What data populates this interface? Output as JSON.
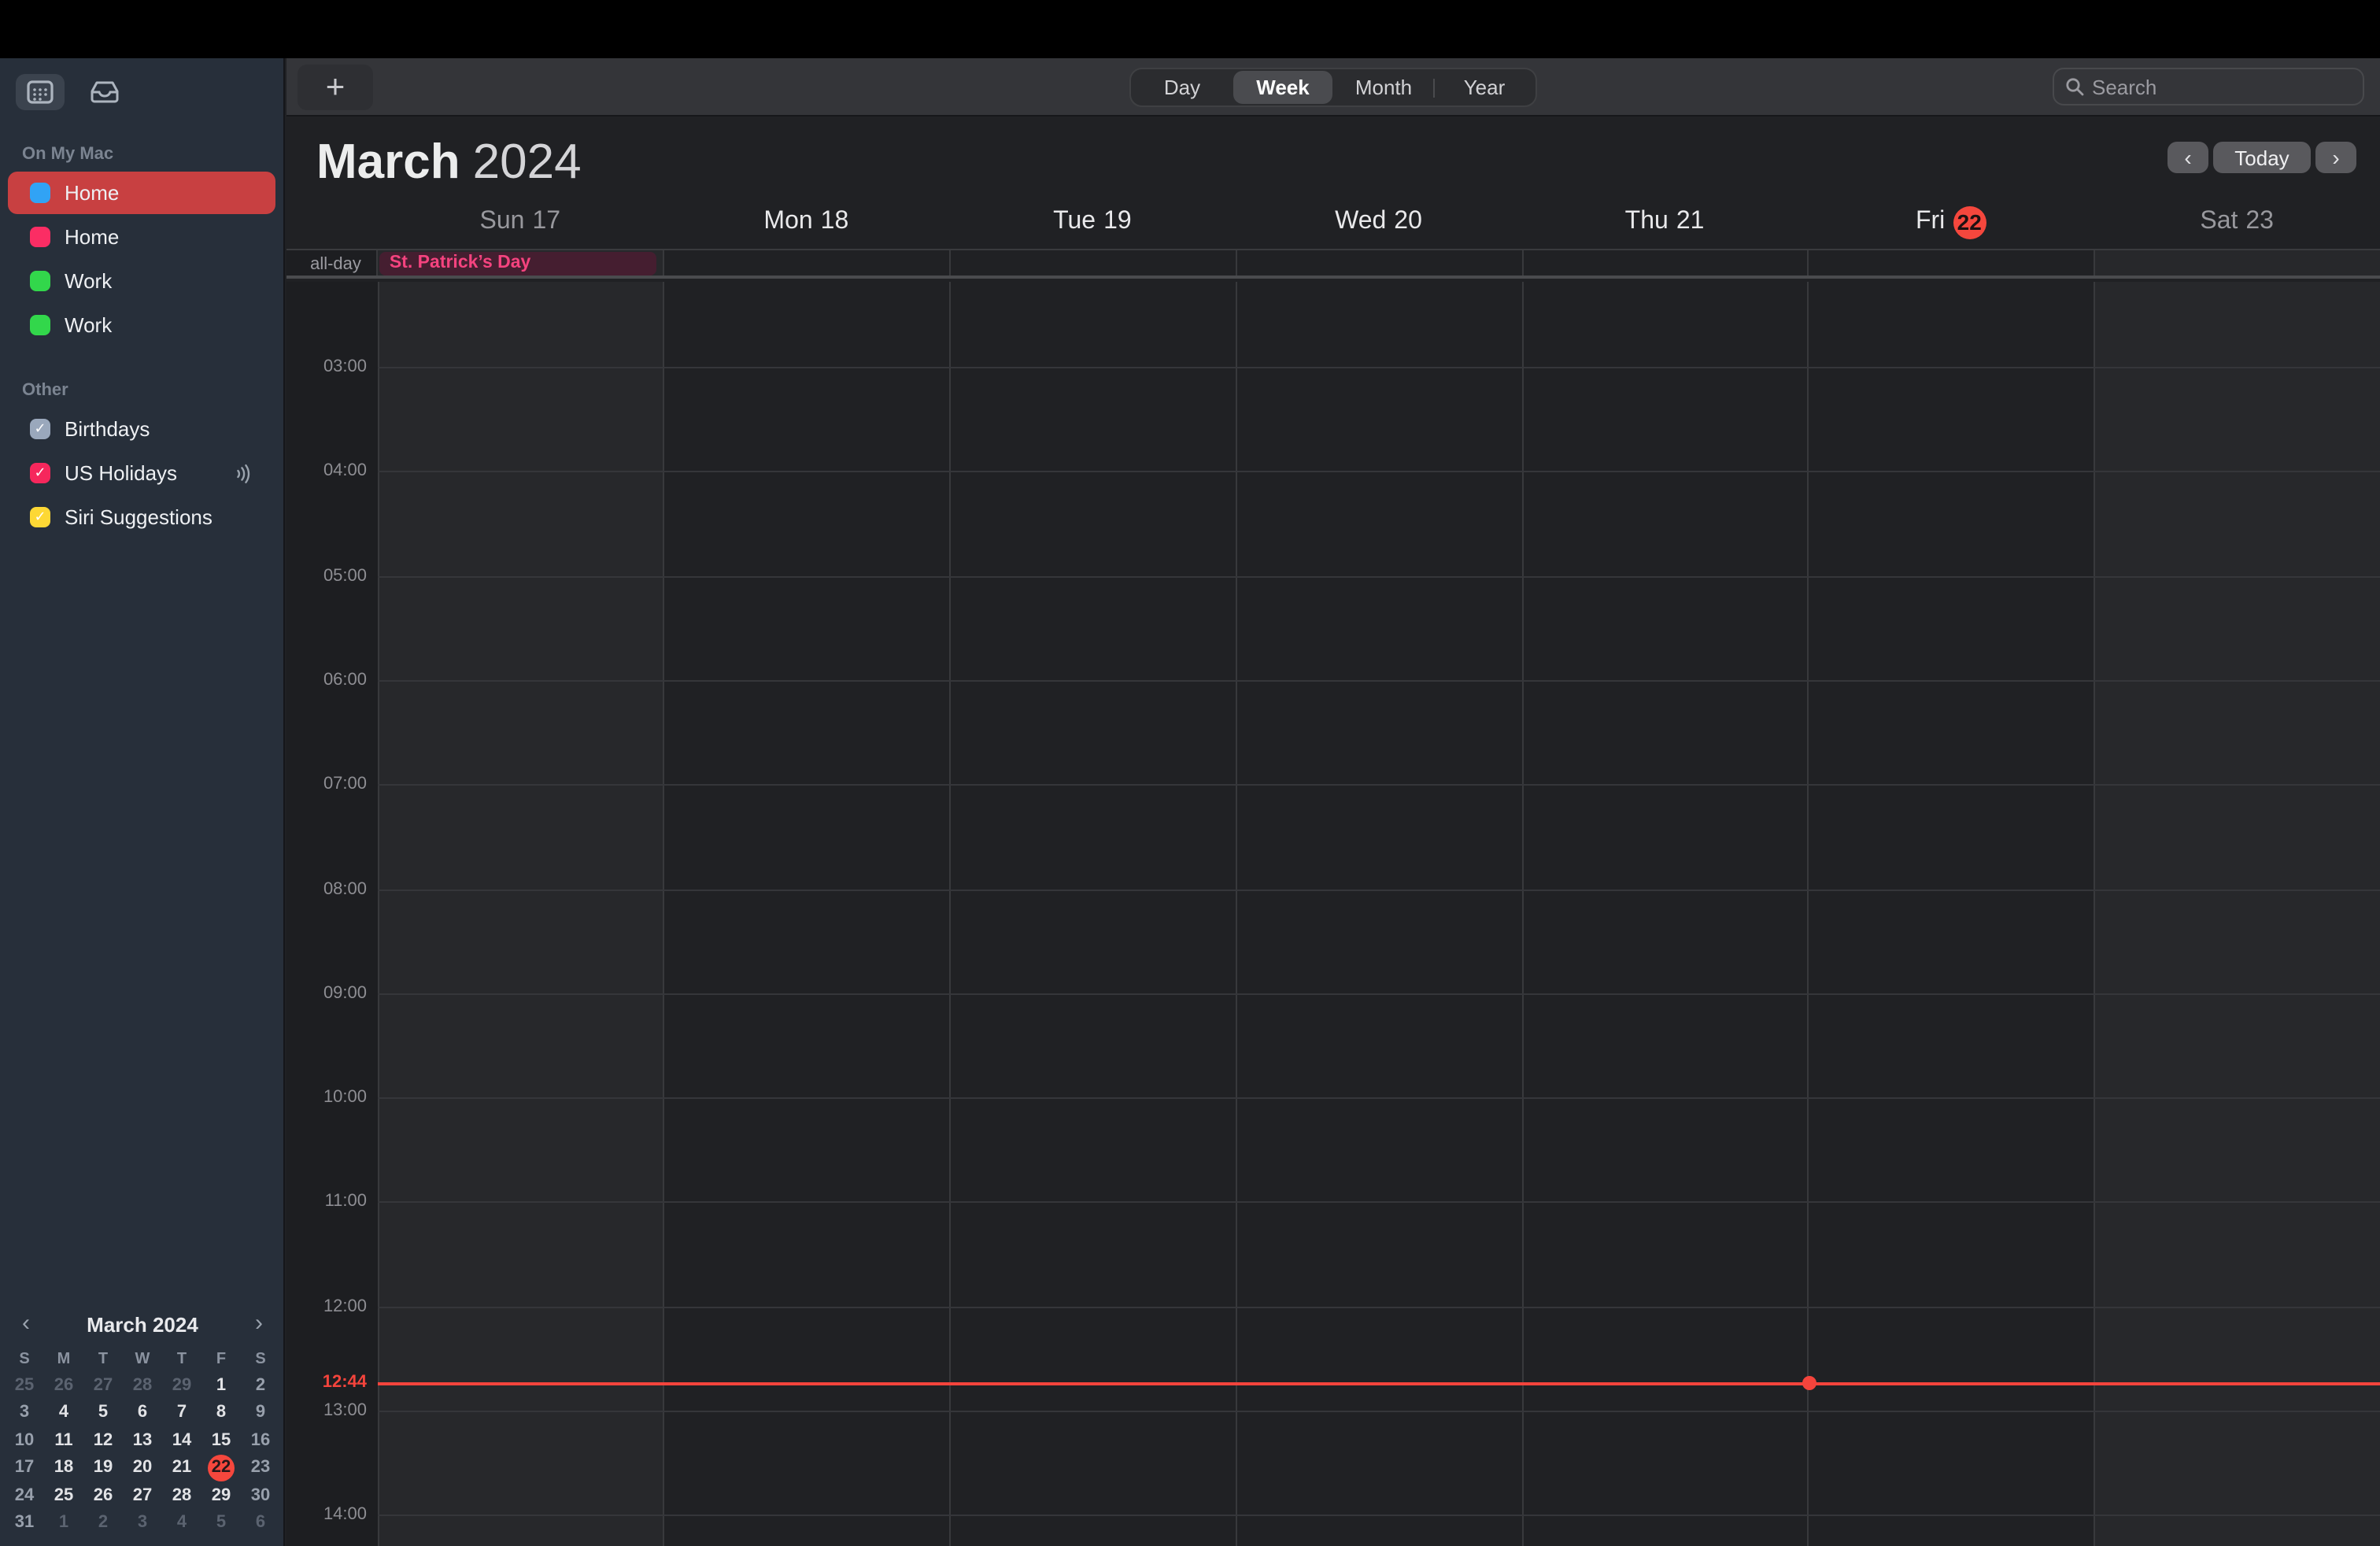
{
  "toolbar": {
    "add_label": "+",
    "view_options": [
      "Day",
      "Week",
      "Month",
      "Year"
    ],
    "selected_view": "Week",
    "search_placeholder": "Search"
  },
  "sidebar": {
    "icons": [
      {
        "name": "calendar-list-toggle-icon",
        "active": true
      },
      {
        "name": "inbox-icon",
        "active": false
      }
    ],
    "sections": [
      {
        "label": "On My Mac",
        "items": [
          {
            "label": "Home",
            "color": "#31a3f5",
            "checked": false,
            "selected": true
          },
          {
            "label": "Home",
            "color": "#fb2d64",
            "checked": false,
            "selected": false
          },
          {
            "label": "Work",
            "color": "#32d74b",
            "checked": false,
            "selected": false
          },
          {
            "label": "Work",
            "color": "#32d74b",
            "checked": false,
            "selected": false
          }
        ]
      },
      {
        "label": "Other",
        "items": [
          {
            "label": "Birthdays",
            "color": "#9aa8bc",
            "checked": true,
            "selected": false
          },
          {
            "label": "US Holidays",
            "color": "#f6275c",
            "checked": true,
            "selected": false,
            "subscribed": true
          },
          {
            "label": "Siri Suggestions",
            "color": "#fdd835",
            "checked": true,
            "selected": false
          }
        ]
      }
    ],
    "mini_calendar": {
      "title": "March 2024",
      "prev": "‹",
      "next": "›",
      "weekdays": [
        "S",
        "M",
        "T",
        "W",
        "T",
        "F",
        "S"
      ],
      "today": 22,
      "rows": [
        [
          {
            "d": 25,
            "s": "dim"
          },
          {
            "d": 26,
            "s": "dim"
          },
          {
            "d": 27,
            "s": "dim"
          },
          {
            "d": 28,
            "s": "dim"
          },
          {
            "d": 29,
            "s": "dim"
          },
          {
            "d": 1,
            "s": "wk"
          },
          {
            "d": 2,
            "s": "we"
          }
        ],
        [
          {
            "d": 3,
            "s": "we"
          },
          {
            "d": 4,
            "s": "wk"
          },
          {
            "d": 5,
            "s": "wk"
          },
          {
            "d": 6,
            "s": "wk"
          },
          {
            "d": 7,
            "s": "wk"
          },
          {
            "d": 8,
            "s": "wk"
          },
          {
            "d": 9,
            "s": "we"
          }
        ],
        [
          {
            "d": 10,
            "s": "we"
          },
          {
            "d": 11,
            "s": "wk"
          },
          {
            "d": 12,
            "s": "wk"
          },
          {
            "d": 13,
            "s": "wk"
          },
          {
            "d": 14,
            "s": "wk"
          },
          {
            "d": 15,
            "s": "wk"
          },
          {
            "d": 16,
            "s": "we"
          }
        ],
        [
          {
            "d": 17,
            "s": "we"
          },
          {
            "d": 18,
            "s": "wk"
          },
          {
            "d": 19,
            "s": "wk"
          },
          {
            "d": 20,
            "s": "wk"
          },
          {
            "d": 21,
            "s": "wk"
          },
          {
            "d": 22,
            "s": "today"
          },
          {
            "d": 23,
            "s": "we"
          }
        ],
        [
          {
            "d": 24,
            "s": "we"
          },
          {
            "d": 25,
            "s": "wk"
          },
          {
            "d": 26,
            "s": "wk"
          },
          {
            "d": 27,
            "s": "wk"
          },
          {
            "d": 28,
            "s": "wk"
          },
          {
            "d": 29,
            "s": "wk"
          },
          {
            "d": 30,
            "s": "we"
          }
        ],
        [
          {
            "d": 31,
            "s": "we"
          },
          {
            "d": 1,
            "s": "dim"
          },
          {
            "d": 2,
            "s": "dim"
          },
          {
            "d": 3,
            "s": "dim"
          },
          {
            "d": 4,
            "s": "dim"
          },
          {
            "d": 5,
            "s": "dim"
          },
          {
            "d": 6,
            "s": "dim"
          }
        ]
      ]
    }
  },
  "header": {
    "month": "March",
    "year": "2024",
    "prev": "‹",
    "next": "›",
    "today_label": "Today"
  },
  "week": {
    "days": [
      {
        "name": "Sun",
        "num": "17",
        "weekend": true,
        "today": false
      },
      {
        "name": "Mon",
        "num": "18",
        "weekend": false,
        "today": false
      },
      {
        "name": "Tue",
        "num": "19",
        "weekend": false,
        "today": false
      },
      {
        "name": "Wed",
        "num": "20",
        "weekend": false,
        "today": false
      },
      {
        "name": "Thu",
        "num": "21",
        "weekend": false,
        "today": false
      },
      {
        "name": "Fri",
        "num": "22",
        "weekend": false,
        "today": true
      },
      {
        "name": "Sat",
        "num": "23",
        "weekend": true,
        "today": false
      }
    ],
    "all_day_label": "all-day",
    "all_day_events": [
      {
        "title": "St. Patrick’s Day",
        "day": 0,
        "text_color": "#f5437f",
        "bg_color": "#451e30"
      }
    ],
    "hours": [
      "03:00",
      "04:00",
      "05:00",
      "06:00",
      "07:00",
      "08:00",
      "09:00",
      "10:00",
      "11:00",
      "12:00",
      "13:00",
      "14:00"
    ],
    "now": {
      "time": "12:44",
      "day": 5
    }
  },
  "colors": {
    "accent_red": "#f5473d",
    "selected_calendar_bg": "#c84041",
    "today_badge": "#f5473d"
  }
}
